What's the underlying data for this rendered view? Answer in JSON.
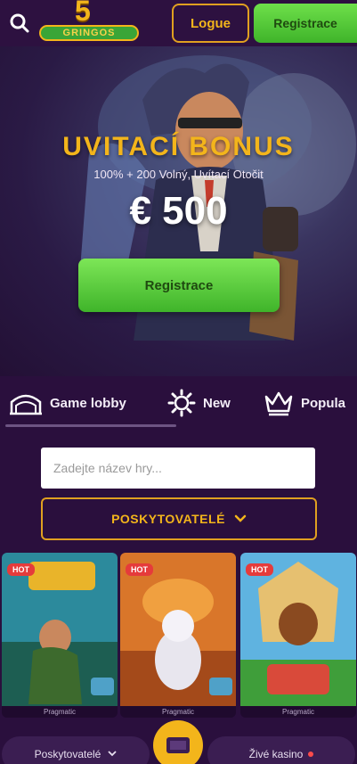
{
  "header": {
    "logo_number": "5",
    "logo_word": "GRINGOS",
    "login_label": "Logue",
    "register_label": "Registrace"
  },
  "hero": {
    "title": "UVITACÍ BONUS",
    "subtitle": "100% + 200 Volný, Uvítací Otočit",
    "amount": "€ 500",
    "cta_label": "Registrace"
  },
  "tabs": [
    {
      "label": "Game lobby",
      "icon": "lobby-icon"
    },
    {
      "label": "New",
      "icon": "gear-icon"
    },
    {
      "label": "Popula",
      "icon": "crown-icon"
    }
  ],
  "search": {
    "placeholder": "Zadejte název hry..."
  },
  "providers": {
    "label": "POSKYTOVATELÉ"
  },
  "games": [
    {
      "badge": "HOT",
      "caption": "Pragmatic"
    },
    {
      "badge": "HOT",
      "caption": "Pragmatic"
    },
    {
      "badge": "HOT",
      "caption": "Pragmatic"
    }
  ],
  "bottom_bar": {
    "left_label": "Poskytovatelé",
    "right_label": "Živé kasino"
  },
  "colors": {
    "background": "#2a0f3d",
    "accent_gold": "#f3b51b",
    "cta_green": "#4fc634"
  }
}
